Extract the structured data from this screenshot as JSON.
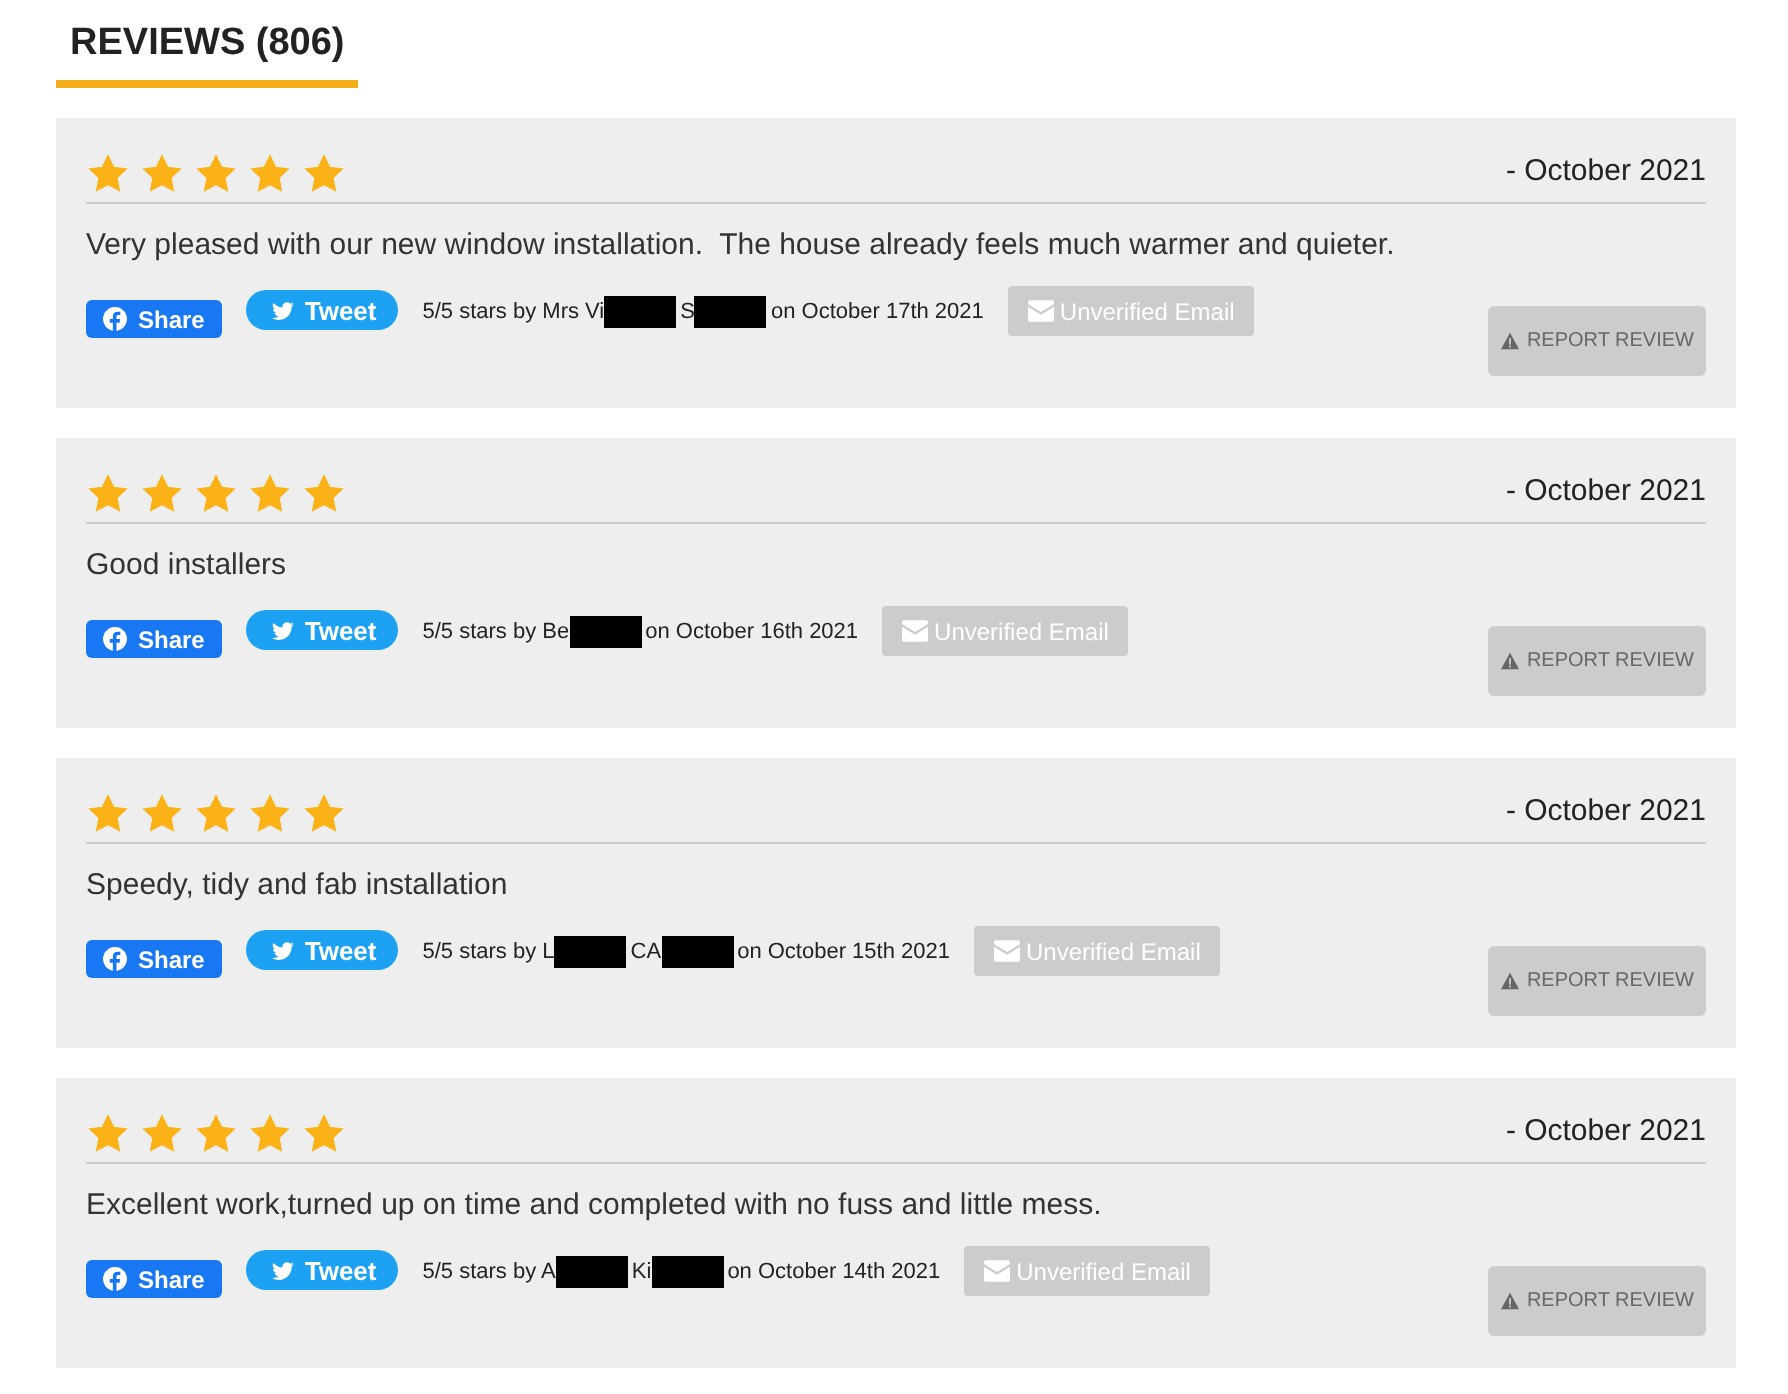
{
  "heading": {
    "title": "REVIEWS (806)"
  },
  "reviews": [
    {
      "stars": 5,
      "date": "- October 2021",
      "text": "Very pleased with our new window installation.  The house already feels much warmer and quieter.",
      "share_button": "Share",
      "tweet_button": "Tweet",
      "byline": [
        {
          "kind": "text",
          "text": "5/5 stars by Mrs Vi"
        },
        {
          "kind": "redacted"
        },
        {
          "kind": "text",
          "text": "S"
        },
        {
          "kind": "redacted"
        },
        {
          "kind": "text",
          "text": "on October 17th 2021"
        }
      ],
      "email_badge": "Unverified Email",
      "report_button": "REPORT REVIEW"
    },
    {
      "stars": 5,
      "date": "- October 2021",
      "text": "Good installers",
      "share_button": "Share",
      "tweet_button": "Tweet",
      "byline": [
        {
          "kind": "text",
          "text": "5/5 stars by Be"
        },
        {
          "kind": "redacted"
        },
        {
          "kind": "text",
          "text": "on October 16th 2021"
        }
      ],
      "email_badge": "Unverified Email",
      "report_button": "REPORT REVIEW"
    },
    {
      "stars": 5,
      "date": "- October 2021",
      "text": "Speedy, tidy and fab installation",
      "share_button": "Share",
      "tweet_button": "Tweet",
      "byline": [
        {
          "kind": "text",
          "text": "5/5 stars by L"
        },
        {
          "kind": "redacted"
        },
        {
          "kind": "text",
          "text": "CA"
        },
        {
          "kind": "redacted"
        },
        {
          "kind": "text",
          "text": "on October 15th 2021"
        }
      ],
      "email_badge": "Unverified Email",
      "report_button": "REPORT REVIEW"
    },
    {
      "stars": 5,
      "date": "- October 2021",
      "text": "Excellent work,turned up on time and completed with no fuss and little mess.",
      "share_button": "Share",
      "tweet_button": "Tweet",
      "byline": [
        {
          "kind": "text",
          "text": "5/5 stars by A"
        },
        {
          "kind": "redacted"
        },
        {
          "kind": "text",
          "text": "Ki"
        },
        {
          "kind": "redacted"
        },
        {
          "kind": "text",
          "text": "on October 14th 2021"
        }
      ],
      "email_badge": "Unverified Email",
      "report_button": "REPORT REVIEW"
    }
  ]
}
